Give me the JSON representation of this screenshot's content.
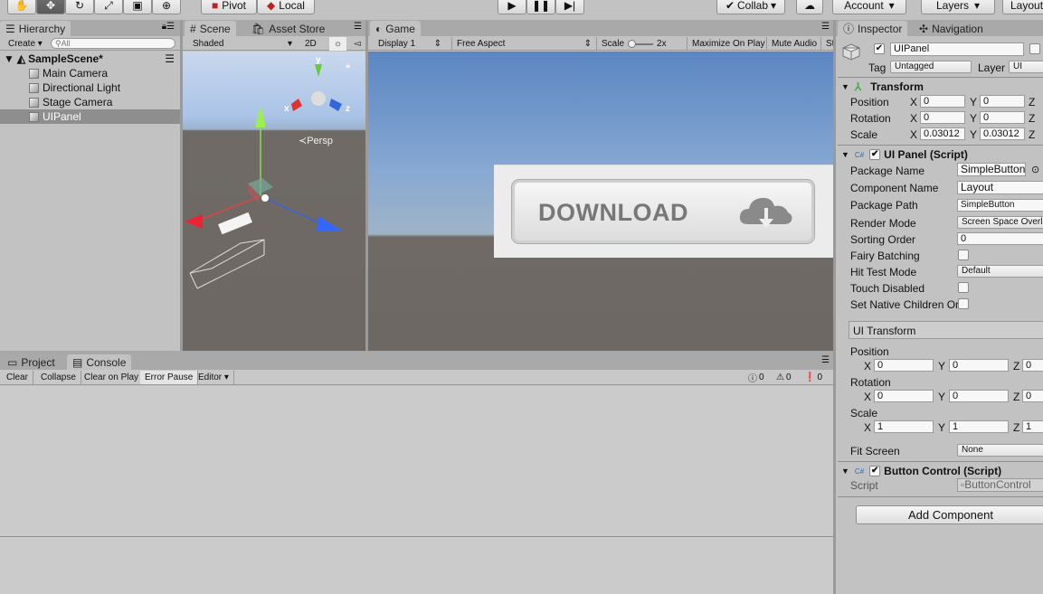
{
  "toolbar": {
    "pivot": "Pivot",
    "local": "Local",
    "collab": "Collab",
    "account": "Account",
    "layers": "Layers",
    "layout": "Layout"
  },
  "hierarchy": {
    "tab": "Hierarchy",
    "create": "Create",
    "search_placeholder": "All",
    "scene": "SampleScene*",
    "items": [
      {
        "label": "Main Camera"
      },
      {
        "label": "Directional Light"
      },
      {
        "label": "Stage Camera"
      },
      {
        "label": "UIPanel"
      }
    ]
  },
  "scene": {
    "tab": "Scene",
    "tab2": "Asset Store",
    "shaded": "Shaded",
    "mode2d": "2D",
    "persp": "Persp",
    "axis_x": "x",
    "axis_y": "y",
    "axis_z": "z"
  },
  "game": {
    "tab": "Game",
    "display": "Display 1",
    "aspect": "Free Aspect",
    "scale_label": "Scale",
    "scale_value": "2x",
    "maximize": "Maximize On Play",
    "mute": "Mute Audio",
    "stats": "St",
    "button_text": "DOWNLOAD"
  },
  "console": {
    "tab_project": "Project",
    "tab_console": "Console",
    "clear": "Clear",
    "collapse": "Collapse",
    "clear_on_play": "Clear on Play",
    "error_pause": "Error Pause",
    "editor": "Editor",
    "count_log": "0",
    "count_warn": "0",
    "count_err": "0"
  },
  "inspector": {
    "tab": "Inspector",
    "tab2": "Navigation",
    "object_name": "UIPanel",
    "tag_label": "Tag",
    "tag_value": "Untagged",
    "layer_label": "Layer",
    "layer_value": "UI",
    "transform": {
      "title": "Transform",
      "position": "Position",
      "rotation": "Rotation",
      "scale": "Scale",
      "x": "X",
      "y": "Y",
      "z": "Z",
      "pos_x": "0",
      "pos_y": "0",
      "rot_x": "0",
      "rot_y": "0",
      "scale_x": "0.03012",
      "scale_y": "0.03012"
    },
    "uipanel": {
      "title": "UI Panel (Script)",
      "package_name_label": "Package Name",
      "package_name": "SimpleButton",
      "component_name_label": "Component Name",
      "component_name": "Layout",
      "package_path_label": "Package Path",
      "package_path": "SimpleButton",
      "render_mode_label": "Render Mode",
      "render_mode": "Screen Space Overlay",
      "sorting_order_label": "Sorting Order",
      "sorting_order": "0",
      "fairy_batching": "Fairy Batching",
      "hit_test_label": "Hit Test Mode",
      "hit_test": "Default",
      "touch_disabled": "Touch Disabled",
      "set_native": "Set Native Children Or"
    },
    "uitransform": {
      "title": "UI Transform",
      "position": "Position",
      "rotation": "Rotation",
      "scale": "Scale",
      "x": "X",
      "y": "Y",
      "z": "Z",
      "pos_x": "0",
      "pos_y": "0",
      "pos_z": "0",
      "rot_x": "0",
      "rot_y": "0",
      "rot_z": "0",
      "scale_x": "1",
      "scale_y": "1",
      "scale_z": "1",
      "fit_screen_label": "Fit Screen",
      "fit_screen": "None"
    },
    "button_control": {
      "title": "Button Control (Script)",
      "script_label": "Script",
      "script": "ButtonControl"
    },
    "add_component": "Add Component"
  }
}
